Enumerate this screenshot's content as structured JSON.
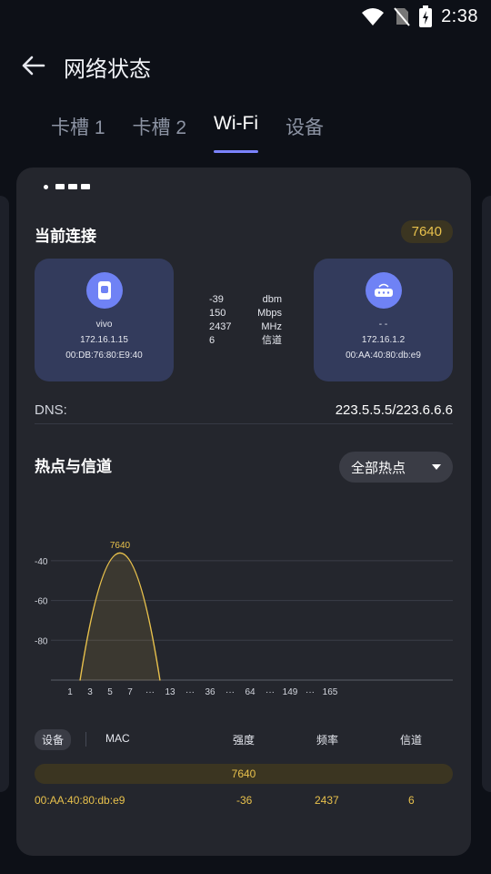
{
  "status_bar": {
    "time": "2:38"
  },
  "header": {
    "title": "网络状态"
  },
  "tabs": [
    {
      "label": "卡槽 1"
    },
    {
      "label": "卡槽 2"
    },
    {
      "label": "Wi-Fi",
      "active": true
    },
    {
      "label": "设备"
    }
  ],
  "connection": {
    "section_title": "当前连接",
    "ssid_badge": "7640",
    "client": {
      "name": "vivo",
      "ip": "172.16.1.15",
      "mac": "00:DB:76:80:E9:40"
    },
    "stats": [
      {
        "value": "-39",
        "unit": "dbm"
      },
      {
        "value": "150",
        "unit": "Mbps"
      },
      {
        "value": "2437",
        "unit": "MHz"
      },
      {
        "value": "6",
        "unit": "信道"
      }
    ],
    "router": {
      "name": "- -",
      "ip": "172.16.1.2",
      "mac": "00:AA:40:80:db:e9"
    }
  },
  "dns": {
    "label": "DNS:",
    "value": "223.5.5.5/223.6.6.6"
  },
  "hotspots": {
    "section_title": "热点与信道",
    "filter": {
      "selected": "全部热点"
    }
  },
  "chart_data": {
    "type": "area",
    "y_ticks": [
      "-40",
      "-60",
      "-80"
    ],
    "x_ticks": [
      "1",
      "3",
      "5",
      "7",
      "···",
      "13",
      "···",
      "36",
      "···",
      "64",
      "···",
      "149",
      "···",
      "165"
    ],
    "ylim": [
      -100,
      -30
    ],
    "series": [
      {
        "name": "7640",
        "channel": 6,
        "value": -36,
        "color": "#e8c14c"
      }
    ],
    "grid": true
  },
  "table": {
    "headers": {
      "device": "设备",
      "mac": "MAC",
      "strength": "强度",
      "freq": "频率",
      "channel": "信道"
    },
    "rows": [
      {
        "ssid": "7640",
        "mac": "00:AA:40:80:db:e9",
        "strength": "-36",
        "freq": "2437",
        "channel": "6"
      }
    ]
  },
  "colors": {
    "accent": "#7b83ff",
    "highlight": "#e8c14c",
    "card": "#24262d",
    "device_box": "#333b5c"
  }
}
